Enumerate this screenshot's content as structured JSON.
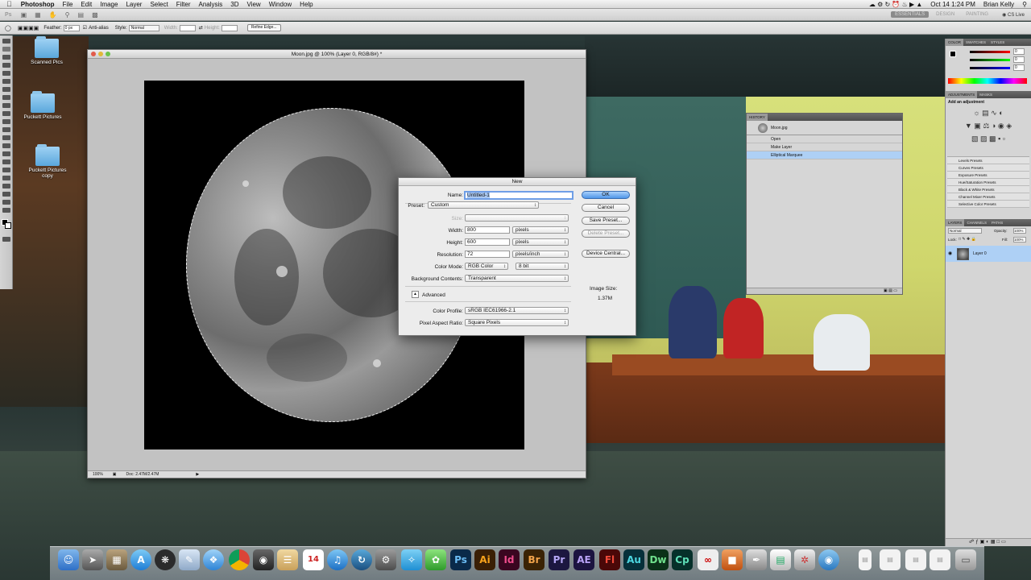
{
  "menubar": {
    "app": "Photoshop",
    "items": [
      "File",
      "Edit",
      "Image",
      "Layer",
      "Select",
      "Filter",
      "Analysis",
      "3D",
      "View",
      "Window",
      "Help"
    ],
    "clock": "Oct 14  1:24 PM",
    "user": "Brian Kelly"
  },
  "appbar": {
    "ps": "Ps",
    "workspaces": [
      "ESSENTIALS",
      "DESIGN",
      "PAINTING"
    ],
    "cslive": "CS Live"
  },
  "options": {
    "feather_label": "Feather:",
    "feather_value": "0 px",
    "antialias_label": "Anti-alias",
    "style_label": "Style:",
    "style_value": "Normal",
    "width_label": "Width:",
    "height_label": "Height:",
    "refine_edge": "Refine Edge..."
  },
  "desktop": {
    "icons": [
      {
        "label": "Scanned Pics"
      },
      {
        "label": "Puckett Pictures"
      },
      {
        "label": "Puckett Pictures copy"
      }
    ]
  },
  "document": {
    "title": "Moon.jpg @ 100% (Layer 0, RGB/8#) *",
    "zoom": "100%",
    "doc_info": "Doc: 2.47M/2.47M"
  },
  "new_dialog": {
    "title": "New",
    "name_label": "Name:",
    "name_value": "Untitled-1",
    "preset_label": "Preset:",
    "preset_value": "Custom",
    "size_label": "Size:",
    "width_label": "Width:",
    "width_value": "800",
    "width_unit": "pixels",
    "height_label": "Height:",
    "height_value": "600",
    "height_unit": "pixels",
    "resolution_label": "Resolution:",
    "resolution_value": "72",
    "resolution_unit": "pixels/inch",
    "color_mode_label": "Color Mode:",
    "color_mode_value": "RGB Color",
    "bit_depth": "8 bit",
    "background_label": "Background Contents:",
    "background_value": "Transparent",
    "advanced_label": "Advanced",
    "profile_label": "Color Profile:",
    "profile_value": "sRGB IEC61966-2.1",
    "aspect_label": "Pixel Aspect Ratio:",
    "aspect_value": "Square Pixels",
    "ok": "OK",
    "cancel": "Cancel",
    "save_preset": "Save Preset...",
    "delete_preset": "Delete Preset...",
    "device_central": "Device Central...",
    "image_size_label": "Image Size:",
    "image_size_value": "1.37M"
  },
  "history": {
    "tab": "HISTORY",
    "snapshot": "Moon.jpg",
    "items": [
      "Open",
      "Make Layer",
      "Elliptical Marquee"
    ]
  },
  "panels": {
    "color_tabs": [
      "COLOR",
      "SWATCHES",
      "STYLES"
    ],
    "color_values": [
      "0",
      "0",
      "0"
    ],
    "adj_tabs": [
      "ADJUSTMENTS",
      "MASKS"
    ],
    "adj_title": "Add an adjustment",
    "presets": [
      "Levels Presets",
      "Curves Presets",
      "Exposure Presets",
      "Hue/Saturation Presets",
      "Black & White Presets",
      "Channel Mixer Presets",
      "Selective Color Presets"
    ],
    "layer_tabs": [
      "LAYERS",
      "CHANNELS",
      "PATHS"
    ],
    "blend_mode": "Normal",
    "opacity_label": "Opacity:",
    "opacity_value": "100%",
    "lock_label": "Lock:",
    "fill_label": "Fill:",
    "fill_value": "100%",
    "layer_name": "Layer 0"
  },
  "dock": {
    "apps": [
      "Ps",
      "Ai",
      "Id",
      "Br",
      "Pr",
      "AE",
      "Fl",
      "Au",
      "Dw",
      "Cp"
    ]
  }
}
